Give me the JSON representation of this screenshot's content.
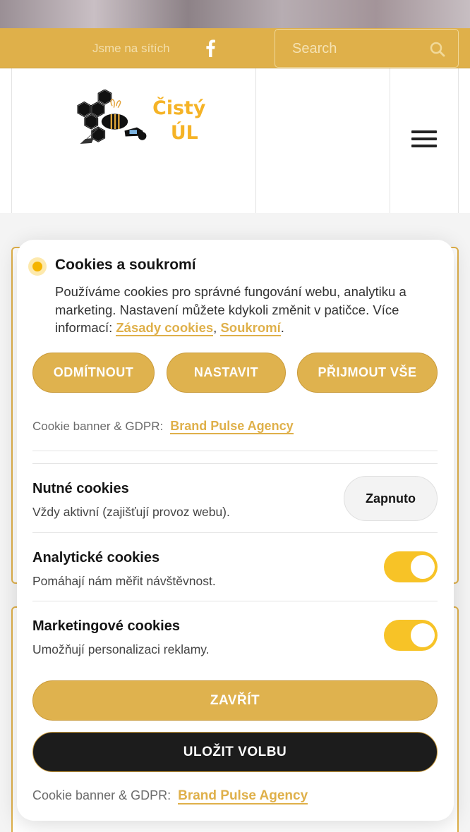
{
  "topbar": {
    "social_label": "Jsme na sítích",
    "search_placeholder": "Search"
  },
  "logo": {
    "line1": "Čistý",
    "line2": "ÚL"
  },
  "colors": {
    "accent": "#dfb04a",
    "toggle_on": "#f7c327",
    "dark_button": "#1c1c1c"
  },
  "cookie_modal": {
    "title": "Cookies a soukromí",
    "description_prefix": "Používáme cookies pro správné fungování webu, analytiku a marketing. Nastavení můžete kdykoli změnit v patičce. Více informací: ",
    "link_cookies": "Zásady cookies",
    "separator": ",",
    "link_privacy": "Soukromí",
    "description_suffix": ".",
    "buttons": {
      "reject": "ODMÍTNOUT",
      "settings": "NASTAVIT",
      "accept_all": "PŘIJMOUT VŠE"
    },
    "credit_label": "Cookie banner & GDPR:",
    "credit_link": "Brand Pulse Agency",
    "categories": [
      {
        "title": "Nutné cookies",
        "description": "Vždy aktivní (zajišťují provoz webu).",
        "status": "Zapnuto"
      },
      {
        "title": "Analytické cookies",
        "description": "Pomáhají nám měřit návštěvnost.",
        "enabled": true
      },
      {
        "title": "Marketingové cookies",
        "description": "Umožňují personalizaci reklamy.",
        "enabled": true
      }
    ],
    "close_button": "ZAVŘÍT",
    "save_button": "ULOŽIT VOLBU",
    "footer_credit_label": "Cookie banner & GDPR:",
    "footer_credit_link": "Brand Pulse Agency"
  }
}
